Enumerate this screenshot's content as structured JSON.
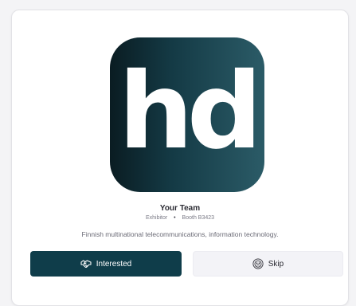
{
  "card": {
    "logo_text": "hd",
    "name": "Your Team",
    "role": "Exhibitor",
    "separator": "•",
    "booth": "Booth B3423",
    "description": "Finnish multinational telecommunications, information technology."
  },
  "actions": {
    "interested_label": "Interested",
    "interested_icon": "handshake-icon",
    "skip_label": "Skip",
    "skip_icon": "face-icon"
  },
  "colors": {
    "primary": "#0f3d4a",
    "logo_gradient_start": "#0a1c22",
    "logo_gradient_end": "#2b5b67",
    "secondary_button": "#f3f3f7"
  }
}
